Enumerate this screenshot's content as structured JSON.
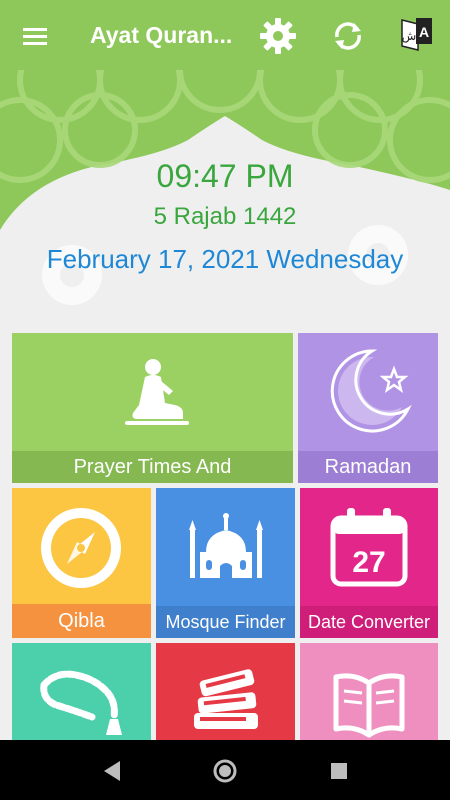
{
  "appbar": {
    "title": "Ayat Quran...",
    "lang_badge_letter": "A",
    "lang_badge_arabic": "ش",
    "icons": [
      "menu-icon",
      "gear-icon",
      "refresh-icon",
      "language-icon"
    ]
  },
  "header": {
    "time": "09:47 PM",
    "hijri_date": "5 Rajab 1442",
    "gregorian_date": "February 17, 2021 Wednesday"
  },
  "tiles": [
    {
      "label": "Prayer Times And",
      "icon": "prayer-icon",
      "color": "#9bd063",
      "label_color": "#86b852"
    },
    {
      "label": "Ramadan",
      "icon": "crescent-star-icon",
      "color": "#b193e6",
      "label_color": "#9c7fd4"
    },
    {
      "label": "Qibla",
      "icon": "compass-icon",
      "color": "#fcc542",
      "label_color": "#f59240"
    },
    {
      "label": "Mosque Finder",
      "icon": "mosque-icon",
      "color": "#4a90e2",
      "label_color": "#3f7fcc"
    },
    {
      "label": "Date Converter",
      "icon": "calendar-icon",
      "color": "#e3278a",
      "label_color": "#cf1e7a"
    },
    {
      "label": "",
      "icon": "tasbih-icon",
      "color": "#4ccfab"
    },
    {
      "label": "",
      "icon": "books-icon",
      "color": "#e53945"
    },
    {
      "label": "",
      "icon": "open-book-icon",
      "color": "#ef8fbf"
    }
  ],
  "calendar_day": "27",
  "colors": {
    "appbar": "#8ec85a",
    "time_text": "#3aa63e",
    "date_text": "#1e88d6"
  },
  "navbar": {
    "icons": [
      "back-icon",
      "home-icon",
      "recents-icon"
    ]
  }
}
